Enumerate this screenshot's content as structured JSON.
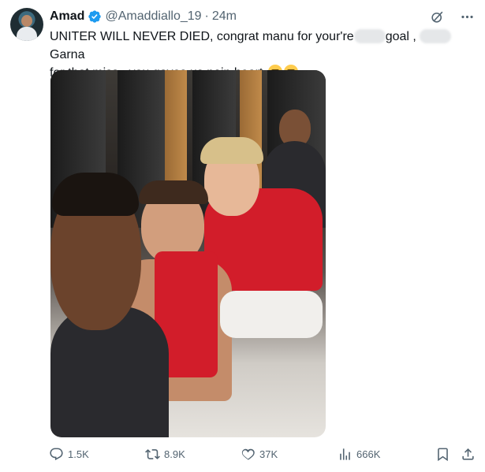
{
  "tweet": {
    "author_name": "Amad",
    "handle": "@Amaddiallo_19",
    "separator": "·",
    "time": "24m",
    "text_line1_a": "UNITER WILL NEVER DIED, congrat manu for your're",
    "text_line1_b": "goal ,",
    "text_line1_c": "Garna",
    "text_line2": "for that miss , you gaves us pain heart"
  },
  "actions": {
    "replies": "1.5K",
    "reposts": "8.9K",
    "likes": "37K",
    "views": "666K"
  },
  "icons": {
    "verified": "verified-badge-icon",
    "grok": "grok-icon",
    "more": "more-icon",
    "reply": "reply-icon",
    "repost": "repost-icon",
    "like": "like-icon",
    "views": "views-icon",
    "bookmark": "bookmark-icon",
    "share": "share-icon"
  },
  "colors": {
    "text": "#0f1419",
    "secondary": "#536471",
    "verified": "#1d9bf0"
  }
}
